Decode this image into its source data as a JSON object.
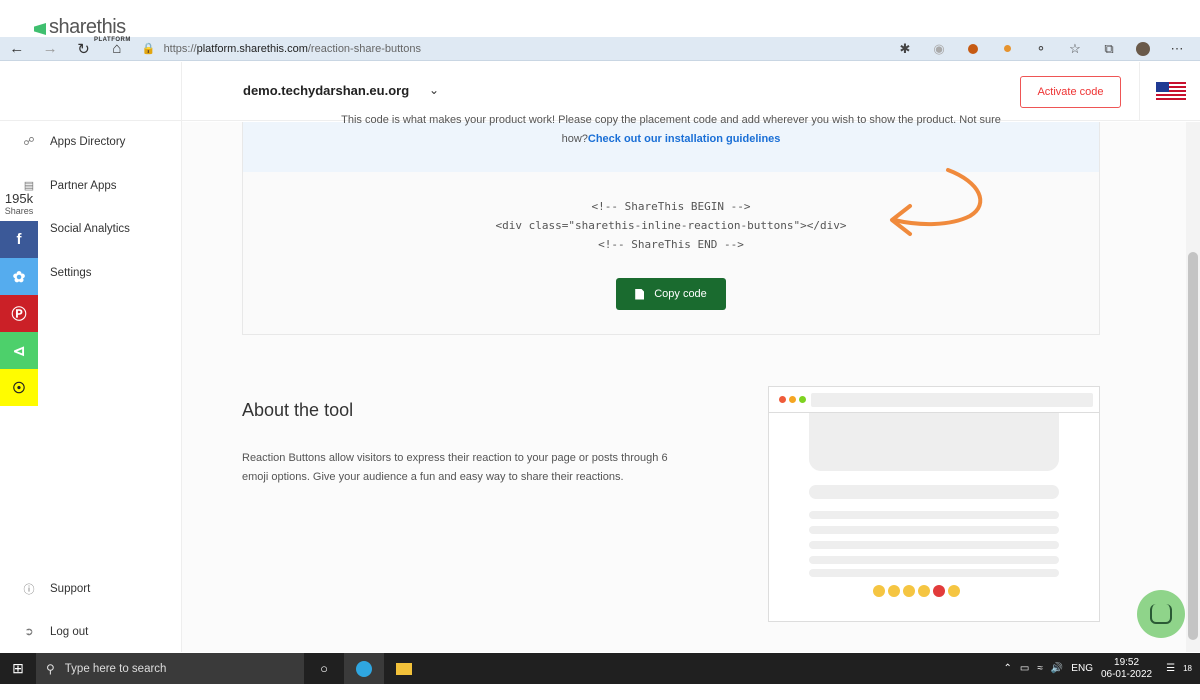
{
  "browser": {
    "url_prefix": "https://",
    "url_host": "platform.sharethis.com",
    "url_path": "/reaction-share-buttons"
  },
  "header": {
    "logo_text": "sharethis",
    "logo_sub": "PLATFORM",
    "domain": "demo.techydarshan.eu.org",
    "activate_label": "Activate code"
  },
  "sidebar": {
    "items": [
      {
        "label": "Apps Directory",
        "icon": "apps-icon"
      },
      {
        "label": "Partner Apps",
        "icon": "partner-icon"
      },
      {
        "label": "Social Analytics",
        "icon": "analytics-icon"
      },
      {
        "label": "Settings",
        "icon": "settings-icon"
      }
    ],
    "support_label": "Support",
    "logout_label": "Log out"
  },
  "share_bar": {
    "count": "195k",
    "count_label": "Shares",
    "colors": {
      "facebook": "#3b5998",
      "twitter": "#55acee",
      "pinterest": "#cb2027",
      "sharethis": "#4dd06b",
      "snapchat": "#fffc00"
    }
  },
  "code_section": {
    "info_line1": "This code is what makes your product work! Please copy the placement code and add wherever you wish to show the product. Not sure",
    "info_line2_prefix": "how?",
    "info_link": "Check out our installation guidelines",
    "code_lines": [
      "<!-- ShareThis BEGIN -->",
      "<div class=\"sharethis-inline-reaction-buttons\"></div>",
      "<!-- ShareThis END -->"
    ],
    "copy_label": "Copy code"
  },
  "about": {
    "title": "About the tool",
    "text": "Reaction Buttons allow visitors to express their reaction to your page or posts through 6 emoji options. Give your audience a fun and easy way to share their reactions."
  },
  "taskbar": {
    "search_placeholder": "Type here to search",
    "lang": "ENG",
    "time": "19:52",
    "date": "06-01-2022",
    "notifications": "18"
  },
  "colors": {
    "accent_red": "#e33333",
    "copy_green": "#1a6b2f",
    "link_blue": "#1a6fd6",
    "arrow_orange": "#f08a3c"
  }
}
